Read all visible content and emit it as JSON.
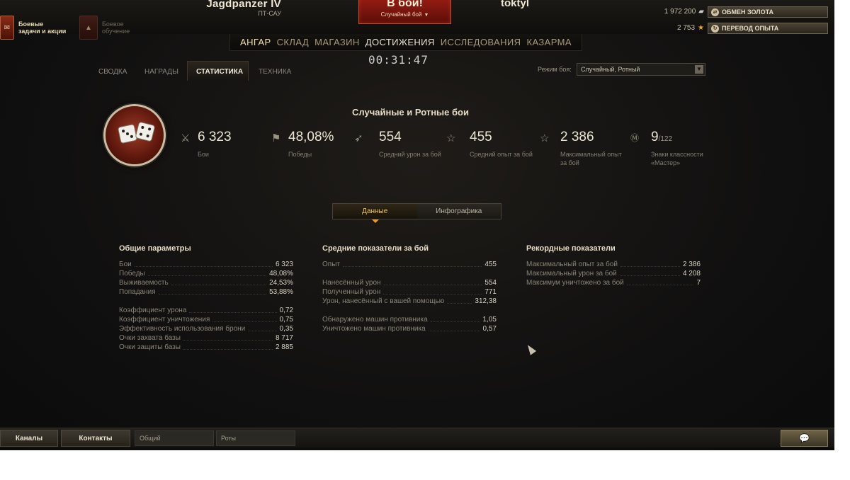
{
  "quests": {
    "label_1": "Боевые",
    "label_2": "задачи и акции",
    "training_1": "Боевое",
    "training_2": "обучение"
  },
  "vehicle": {
    "name": "Jagdpanzer IV",
    "class": "ПТ-САУ"
  },
  "battle": {
    "label": "В бой!",
    "mode": "Случайный бой",
    "mode_arrow": "▼"
  },
  "user": {
    "name": "toktyl"
  },
  "currency": {
    "silver": "1 972 200",
    "free_xp": "2 753"
  },
  "buttons": {
    "exchange_gold": "ОБМЕН ЗОЛОТА",
    "transfer_xp": "ПЕРЕВОД ОПЫТА"
  },
  "nav": [
    "АНГАР",
    "СКЛАД",
    "МАГАЗИН",
    "ДОСТИЖЕНИЯ",
    "ИССЛЕДОВАНИЯ",
    "КАЗАРМА"
  ],
  "timer": "00:31:47",
  "subtabs": [
    "СВОДКА",
    "НАГРАДЫ",
    "СТАТИСТИКА",
    "ТЕХНИКА"
  ],
  "mode_filter": {
    "label": "Режим боя:",
    "value": "Случайный, Ротный"
  },
  "summary": {
    "title": "Случайные и Ротные бои",
    "stats": [
      {
        "value": "6 323",
        "label": "Бои"
      },
      {
        "value": "48,08%",
        "label": "Победы"
      },
      {
        "value": "554",
        "label": "Средний урон за бой"
      },
      {
        "value": "455",
        "label": "Средний опыт за бой"
      },
      {
        "value": "2 386",
        "label": "Максимальный опыт за бой"
      },
      {
        "value": "9",
        "suffix": "/122",
        "label": "Знаки классности «Мастер»"
      }
    ]
  },
  "toggle": {
    "data": "Данные",
    "info": "Инфографика"
  },
  "columns": {
    "general": {
      "title": "Общие параметры",
      "rows": [
        {
          "label": "Бои",
          "value": "6 323"
        },
        {
          "label": "Победы",
          "value": "48,08%"
        },
        {
          "label": "Выживаемость",
          "value": "24,53%"
        },
        {
          "label": "Попадания",
          "value": "53,88%"
        },
        {
          "label": "Коэффициент урона",
          "value": "0,72"
        },
        {
          "label": "Коэффициент уничтожения",
          "value": "0,75"
        },
        {
          "label": "Эффективность использования брони",
          "value": "0,35"
        },
        {
          "label": "Очки захвата базы",
          "value": "8 717"
        },
        {
          "label": "Очки защиты базы",
          "value": "2 885"
        }
      ]
    },
    "average": {
      "title": "Средние показатели за бой",
      "rows": [
        {
          "label": "Опыт",
          "value": "455"
        },
        {
          "label": "Нанесённый урон",
          "value": "554"
        },
        {
          "label": "Полученный урон",
          "value": "771"
        },
        {
          "label": "Урон, нанесённый с вашей помощью",
          "value": "312,38"
        },
        {
          "label": "Обнаружено машин противника",
          "value": "1,05"
        },
        {
          "label": "Уничтожено машин противника",
          "value": "0,57"
        }
      ]
    },
    "records": {
      "title": "Рекордные показатели",
      "rows": [
        {
          "label": "Максимальный опыт за бой",
          "value": "2 386"
        },
        {
          "label": "Максимальный урон за бой",
          "value": "4 208"
        },
        {
          "label": "Максимум уничтожено за бой",
          "value": "7"
        }
      ]
    }
  },
  "bottom": {
    "channels": "Каналы",
    "contacts": "Контакты",
    "chat_general": "Общий",
    "chat_company": "Роты"
  }
}
